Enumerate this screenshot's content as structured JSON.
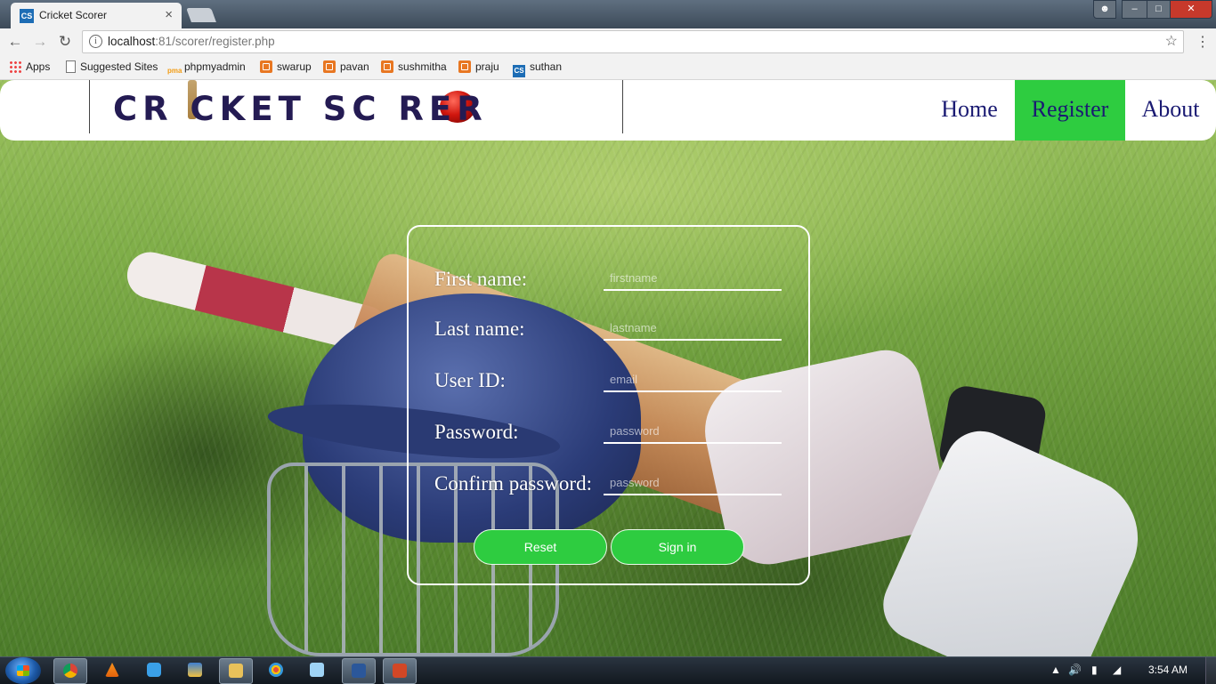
{
  "browser": {
    "tab_favicon": "CS",
    "tab_title": "Cricket Scorer",
    "tab_close": "×",
    "url_host": "localhost",
    "url_path": ":81/scorer/register.php",
    "icons": {
      "back": "back-arrow-icon",
      "forward": "forward-arrow-icon",
      "reload": "reload-icon",
      "info": "info-icon",
      "star": "bookmark-star-icon",
      "menu": "kebab-menu-icon"
    },
    "bookmarks": [
      {
        "label": "Apps",
        "icon": "apps-grid-icon"
      },
      {
        "label": "Suggested Sites",
        "icon": "page-icon"
      },
      {
        "label": "phpmyadmin",
        "icon": "phpmyadmin-icon"
      },
      {
        "label": "swarup",
        "icon": "xampp-icon"
      },
      {
        "label": "pavan",
        "icon": "xampp-icon"
      },
      {
        "label": "sushmitha",
        "icon": "xampp-icon"
      },
      {
        "label": "praju",
        "icon": "xampp-icon"
      },
      {
        "label": "suthan",
        "icon": "cs-icon"
      }
    ]
  },
  "site": {
    "logo_text": "CR CKET  SC RER",
    "nav": [
      {
        "label": "Home",
        "active": false
      },
      {
        "label": "Register",
        "active": true
      },
      {
        "label": "About",
        "active": false
      }
    ],
    "accent_color": "#2ecc40",
    "nav_text_color": "#1a1a72"
  },
  "form": {
    "fields": [
      {
        "label": "First name:",
        "placeholder": "firstname",
        "value": ""
      },
      {
        "label": "Last name:",
        "placeholder": "lastname",
        "value": ""
      },
      {
        "label": "User ID:",
        "placeholder": "email",
        "value": ""
      },
      {
        "label": "Password:",
        "placeholder": "password",
        "value": ""
      },
      {
        "label": "Confirm password:",
        "placeholder": "password",
        "value": ""
      }
    ],
    "reset_label": "Reset",
    "submit_label": "Sign in"
  },
  "taskbar": {
    "clock": "3:54 AM",
    "apps": [
      "chrome-icon",
      "vlc-icon",
      "network-icon",
      "sticky-icon",
      "explorer-icon",
      "paint-icon",
      "notepad-icon",
      "word-icon",
      "powerpoint-icon"
    ]
  }
}
